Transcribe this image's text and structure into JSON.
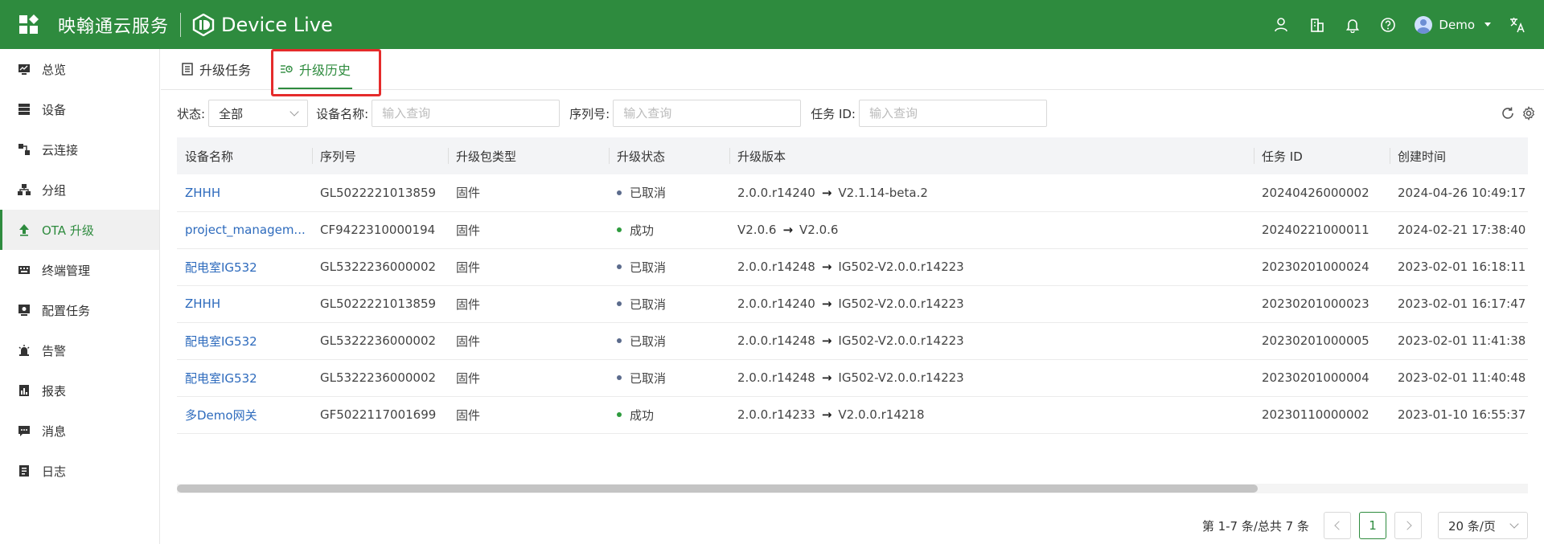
{
  "header": {
    "brand": "映翰通云服务",
    "product": "Device Live",
    "user_name": "Demo",
    "icons": [
      "apps-icon",
      "user-group-icon",
      "building-icon",
      "bell-icon",
      "help-icon",
      "translate-icon"
    ],
    "colors": {
      "bar": "#2e8b3e"
    }
  },
  "sidebar": {
    "items": [
      {
        "label": "总览",
        "icon": "dashboard-icon"
      },
      {
        "label": "设备",
        "icon": "device-icon"
      },
      {
        "label": "云连接",
        "icon": "cloud-link-icon"
      },
      {
        "label": "分组",
        "icon": "group-icon"
      },
      {
        "label": "OTA 升级",
        "icon": "upload-icon",
        "active": true
      },
      {
        "label": "终端管理",
        "icon": "keyboard-icon"
      },
      {
        "label": "配置任务",
        "icon": "config-task-icon"
      },
      {
        "label": "告警",
        "icon": "alarm-icon"
      },
      {
        "label": "报表",
        "icon": "report-icon"
      },
      {
        "label": "消息",
        "icon": "message-icon"
      },
      {
        "label": "日志",
        "icon": "log-icon"
      }
    ]
  },
  "tabs": [
    {
      "label": "升级任务",
      "icon": "task-list-icon"
    },
    {
      "label": "升级历史",
      "icon": "history-icon",
      "active": true
    }
  ],
  "filters": {
    "status_label": "状态:",
    "status_value": "全部",
    "device_name_label": "设备名称:",
    "device_name_placeholder": "输入查询",
    "serial_label": "序列号:",
    "serial_placeholder": "输入查询",
    "task_id_label": "任务 ID:",
    "task_id_placeholder": "输入查询"
  },
  "table": {
    "columns": [
      "设备名称",
      "序列号",
      "升级包类型",
      "升级状态",
      "升级版本",
      "任务 ID",
      "创建时间"
    ],
    "rows": [
      {
        "name": "ZHHH",
        "serial": "GL5022221013859",
        "type": "固件",
        "status": "已取消",
        "status_color": "#5b6b8c",
        "from": "2.0.0.r14240",
        "to": "V2.1.14-beta.2",
        "task_id": "20240426000002",
        "created": "2024-04-26 10:49:17"
      },
      {
        "name": "project_managem...",
        "serial": "CF9422310000194",
        "type": "固件",
        "status": "成功",
        "status_color": "#2e9b3e",
        "from": "V2.0.6",
        "to": "V2.0.6",
        "task_id": "20240221000011",
        "created": "2024-02-21 17:38:40"
      },
      {
        "name": "配电室IG532",
        "serial": "GL5322236000002",
        "type": "固件",
        "status": "已取消",
        "status_color": "#5b6b8c",
        "from": "2.0.0.r14248",
        "to": "IG502-V2.0.0.r14223",
        "task_id": "20230201000024",
        "created": "2023-02-01 16:18:11"
      },
      {
        "name": "ZHHH",
        "serial": "GL5022221013859",
        "type": "固件",
        "status": "已取消",
        "status_color": "#5b6b8c",
        "from": "2.0.0.r14240",
        "to": "IG502-V2.0.0.r14223",
        "task_id": "20230201000023",
        "created": "2023-02-01 16:17:47"
      },
      {
        "name": "配电室IG532",
        "serial": "GL5322236000002",
        "type": "固件",
        "status": "已取消",
        "status_color": "#5b6b8c",
        "from": "2.0.0.r14248",
        "to": "IG502-V2.0.0.r14223",
        "task_id": "20230201000005",
        "created": "2023-02-01 11:41:38"
      },
      {
        "name": "配电室IG532",
        "serial": "GL5322236000002",
        "type": "固件",
        "status": "已取消",
        "status_color": "#5b6b8c",
        "from": "2.0.0.r14248",
        "to": "IG502-V2.0.0.r14223",
        "task_id": "20230201000004",
        "created": "2023-02-01 11:40:48"
      },
      {
        "name": "多Demo网关",
        "serial": "GF5022117001699",
        "type": "固件",
        "status": "成功",
        "status_color": "#2e9b3e",
        "from": "2.0.0.r14233",
        "to": "V2.0.0.r14218",
        "task_id": "20230110000002",
        "created": "2023-01-10 16:55:37"
      }
    ]
  },
  "pagination": {
    "summary": "第 1-7 条/总共 7 条",
    "current_page": "1",
    "page_size": "20 条/页"
  }
}
